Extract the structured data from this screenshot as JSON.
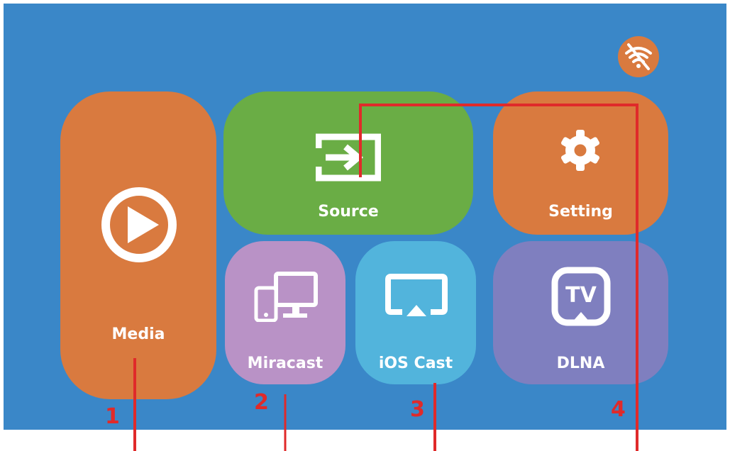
{
  "tiles": {
    "media": {
      "label": "Media",
      "icon": "play-icon",
      "color": "#d97a3f"
    },
    "source": {
      "label": "Source",
      "icon": "input-source-icon",
      "color": "#6aad45"
    },
    "setting": {
      "label": "Setting",
      "icon": "gear-icon",
      "color": "#d97a3f"
    },
    "miracast": {
      "label": "Miracast",
      "icon": "devices-icon",
      "color": "#b992c6"
    },
    "ios_cast": {
      "label": "iOS Cast",
      "icon": "airplay-icon",
      "color": "#52b4dc"
    },
    "dlna": {
      "label": "DLNA",
      "icon": "tv-icon",
      "icon_text": "TV",
      "color": "#7f7fbf"
    }
  },
  "status": {
    "wifi_icon": "wifi-off-icon"
  },
  "callouts": [
    "1",
    "2",
    "3",
    "4"
  ],
  "colors": {
    "background": "#3a87c8",
    "callout": "#e02a2a"
  }
}
